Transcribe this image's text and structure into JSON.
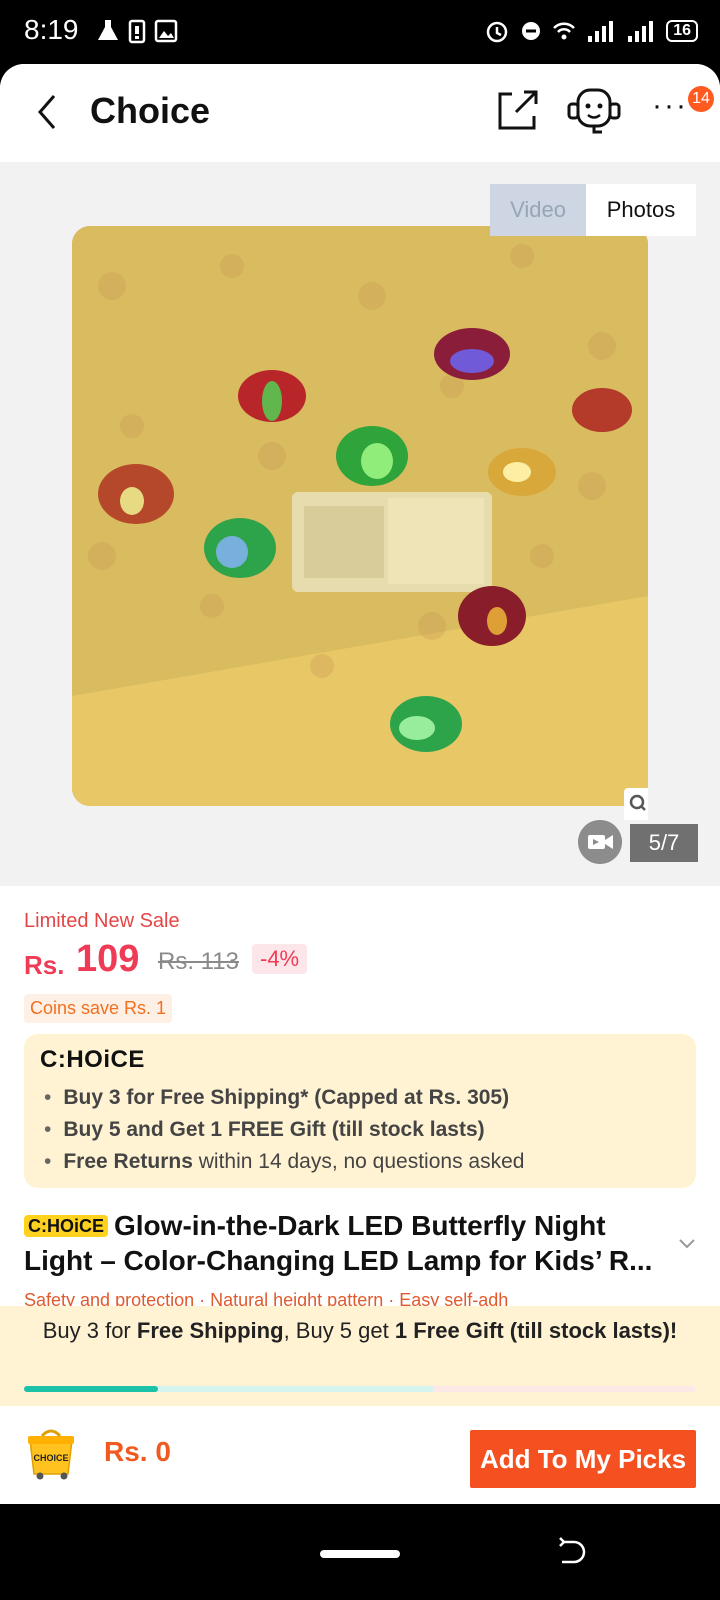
{
  "status_bar": {
    "time": "8:19",
    "battery": "16",
    "icons_left": [
      "flask-icon",
      "battery-saver-icon",
      "image-icon"
    ],
    "icons_right": [
      "alarm-icon",
      "dnd-icon",
      "wifi-icon",
      "signal-icon",
      "signal-icon",
      "battery-icon"
    ]
  },
  "header": {
    "title": "Choice",
    "badge_count": "14",
    "more_label": "···"
  },
  "gallery": {
    "tab_video": "Video",
    "tab_photos": "Photos",
    "active_tab": "Photos",
    "counter": "5/7"
  },
  "product": {
    "sale_label": "Limited New Sale",
    "currency": "Rs.",
    "price": "109",
    "old_price": "Rs. 113",
    "discount": "-4%",
    "coins": "Coins save Rs. 1",
    "choice_logo": "C:HOiCE",
    "choice_benefits": {
      "line1": "Buy 3 for  Free Shipping* (Capped at Rs. 305)",
      "line2": "Buy 5 and Get 1 FREE Gift (till stock lasts)",
      "line3_bold": "Free Returns",
      "line3_rest": " within 14 days, no questions asked"
    },
    "title_tag": "C:HOiCE",
    "title_line1": "Glow-in-the-Dark LED Butterfly Night",
    "title_line2": "Light – Color-Changing LED Lamp for Kids’ R...",
    "peek_text": "Safety and protection · Natural height pattern · Easy self-adh"
  },
  "promo": {
    "part1": "Buy 3 for ",
    "part2": "Free Shipping",
    "part3": ", Buy 5 get ",
    "part4": "1 Free Gift (till stock lasts)!",
    "progress": 0.2
  },
  "bottom": {
    "cart_label": "CHOICE",
    "total": "Rs. 0",
    "add_button": "Add To My Picks"
  },
  "colors": {
    "accent": "#f5501f",
    "price": "#ef3b55",
    "choice_bg": "#fff3d4",
    "progress": "#1bc2a8"
  }
}
